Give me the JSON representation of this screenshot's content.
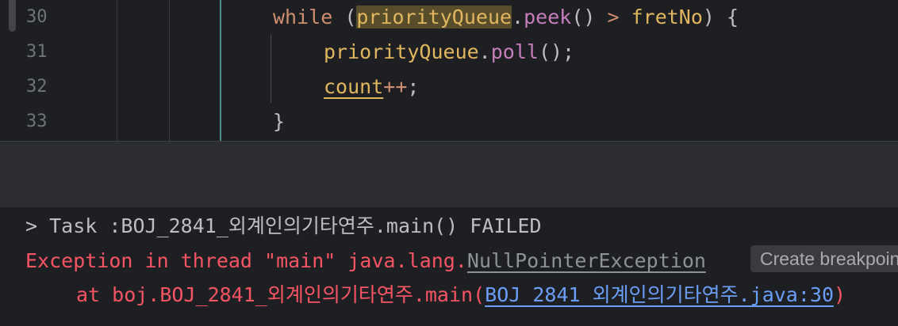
{
  "editor": {
    "lines": [
      {
        "number": "30",
        "kw": "while",
        "paren_open": " (",
        "var": "priorityQueue",
        "dot": ".",
        "method": "peek",
        "call": "()",
        "op": " > ",
        "var2": "fretNo",
        "rest": ") {"
      },
      {
        "number": "31",
        "var": "priorityQueue",
        "dot": ".",
        "method": "poll",
        "rest": "();"
      },
      {
        "number": "32",
        "var": "count",
        "op": "++",
        "rest": ";"
      },
      {
        "number": "33",
        "rest": "}"
      }
    ]
  },
  "console": {
    "task_line": "> Task :BOJ_2841_외계인의기타연주.main() FAILED",
    "exception_prefix": "Exception in thread \"main\" java.lang.",
    "exception_class": "NullPointerException",
    "tooltip": "Create breakpoint",
    "stack_prefix": "at boj.BOJ_2841_외계인의기타연주.main(",
    "stack_link": "BOJ_2841_외계인의기타연주.java:30",
    "stack_suffix": ")"
  },
  "colors": {
    "background": "#1e1f22",
    "band": "#2b2d30",
    "error": "#f75464",
    "link": "#6b9ef8",
    "keyword": "#cf8e6d",
    "method": "#c77dbb",
    "highlight": "#574d2a"
  }
}
